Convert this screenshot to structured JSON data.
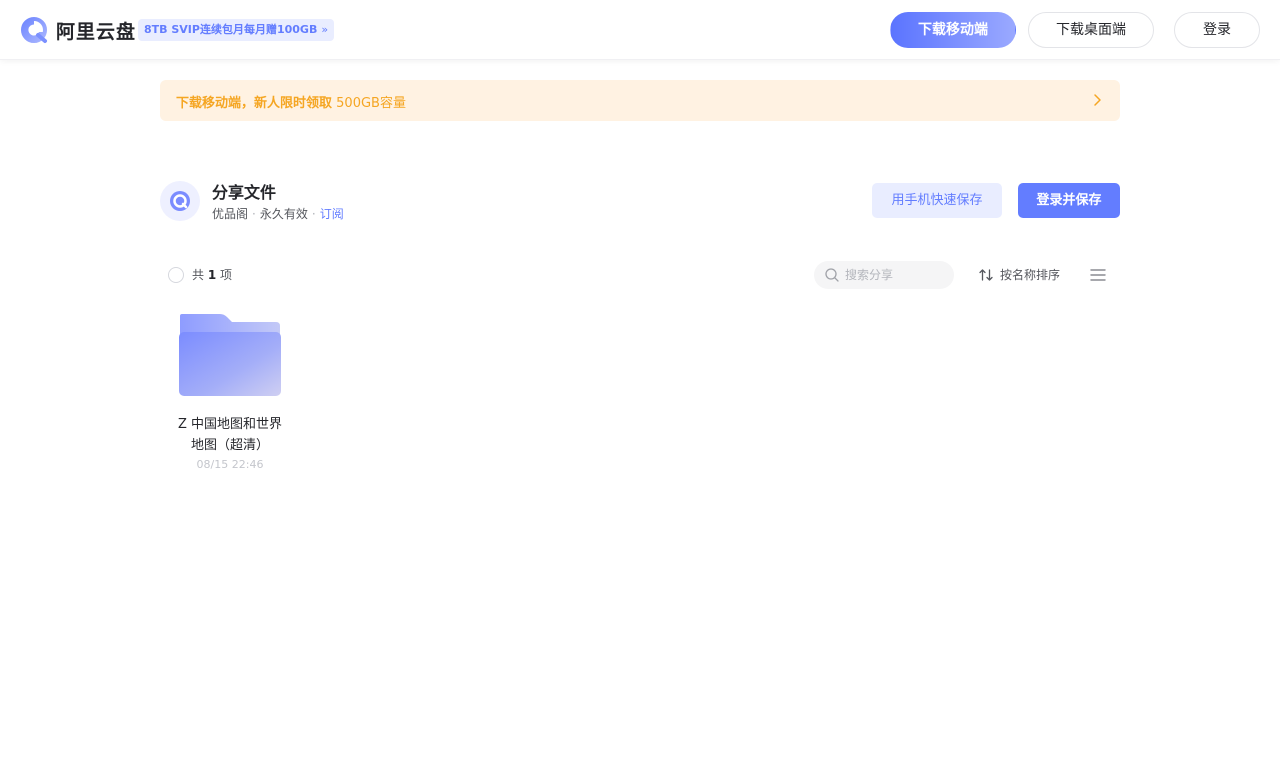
{
  "header": {
    "brand": "阿里云盘",
    "promo": "8TB SVIP连续包月每月赠100GB",
    "promo_chevron": "»",
    "download_mobile": "下载移动端",
    "download_desktop": "下载桌面端",
    "login": "登录"
  },
  "banner": {
    "text_bold": "下载移动端，新人限时领取",
    "text_light": " 500GB容量"
  },
  "share": {
    "title": "分享文件",
    "owner": "优品阁",
    "validity": "永久有效",
    "subscribe": "订阅",
    "separator": "·",
    "phone_save": "用手机快速保存",
    "login_save": "登录并保存"
  },
  "toolbar": {
    "count_prefix": "共 ",
    "count_value": "1",
    "count_suffix": " 项",
    "search_placeholder": "搜索分享",
    "sort_label": "按名称排序"
  },
  "files": [
    {
      "name_line1": "Z 中国地图和世界",
      "name_line2": "地图（超清）",
      "date": "08/15 22:46",
      "icon": "folder-icon"
    }
  ],
  "colors": {
    "accent": "#637dff",
    "banner_bg": "#fff2e2",
    "banner_text": "#f5a623"
  }
}
